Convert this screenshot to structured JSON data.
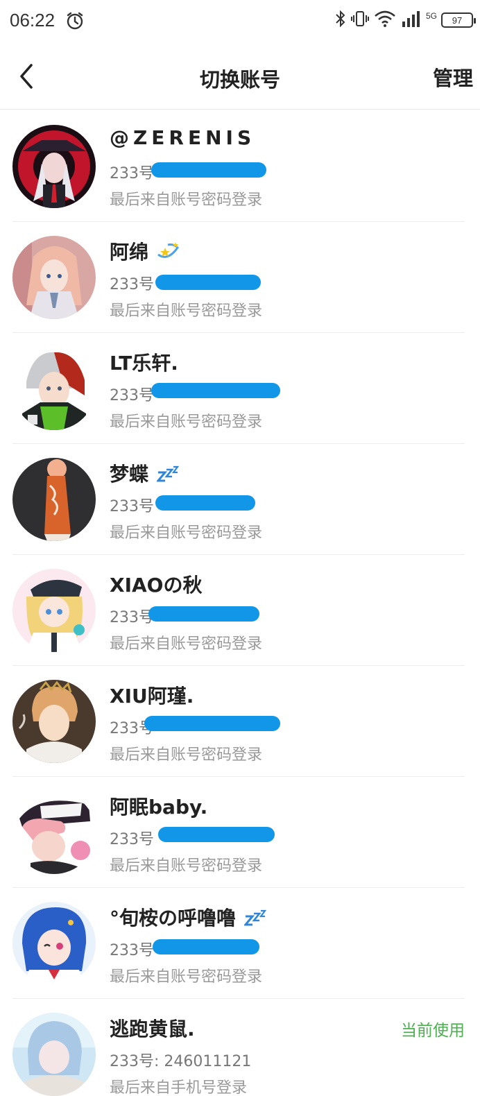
{
  "status_bar": {
    "time": "06:22",
    "network": "5G",
    "battery": "97",
    "icons": [
      "alarm-icon",
      "bluetooth-icon",
      "vibrate-icon",
      "wifi-icon",
      "signal-icon",
      "battery-icon"
    ]
  },
  "header": {
    "title": "切换账号",
    "manage_label": "管理",
    "back_icon": "chevron-left-icon"
  },
  "accounts": [
    {
      "name": "@ZERENIS",
      "id_label": "233号",
      "login_method": "最后来自账号密码登录",
      "current": false
    },
    {
      "name": "阿绵",
      "emoji": "dizzy-star",
      "id_label": "233号",
      "login_method": "最后来自账号密码登录",
      "current": false
    },
    {
      "name": "LT乐轩.",
      "id_label": "233号",
      "login_method": "最后来自账号密码登录",
      "current": false
    },
    {
      "name": "梦蝶",
      "emoji": "zzz",
      "id_label": "233号",
      "login_method": "最后来自账号密码登录",
      "current": false
    },
    {
      "name": "XIAOの秋",
      "id_label": "233号",
      "login_method": "最后来自账号密码登录",
      "current": false
    },
    {
      "name": "XIU阿瑾.",
      "id_label": "233号",
      "login_method": "最后来自账号密码登录",
      "current": false
    },
    {
      "name": "阿眠baby.",
      "id_label": "233号",
      "login_method": "最后来自账号密码登录",
      "current": false
    },
    {
      "name": "°旬桉の呼噜噜",
      "emoji": "zzz",
      "id_label": "233号",
      "login_method": "最后来自账号密码登录",
      "current": false
    },
    {
      "name": "逃跑黄鼠.",
      "id_label": "233号: 246011121",
      "login_method": "最后来自手机号登录",
      "current": true,
      "current_label": "当前使用"
    }
  ],
  "colors": {
    "accent_green": "#4caf50",
    "redaction_blue": "#1297e8",
    "text_primary": "#222222",
    "text_secondary": "#999999"
  }
}
